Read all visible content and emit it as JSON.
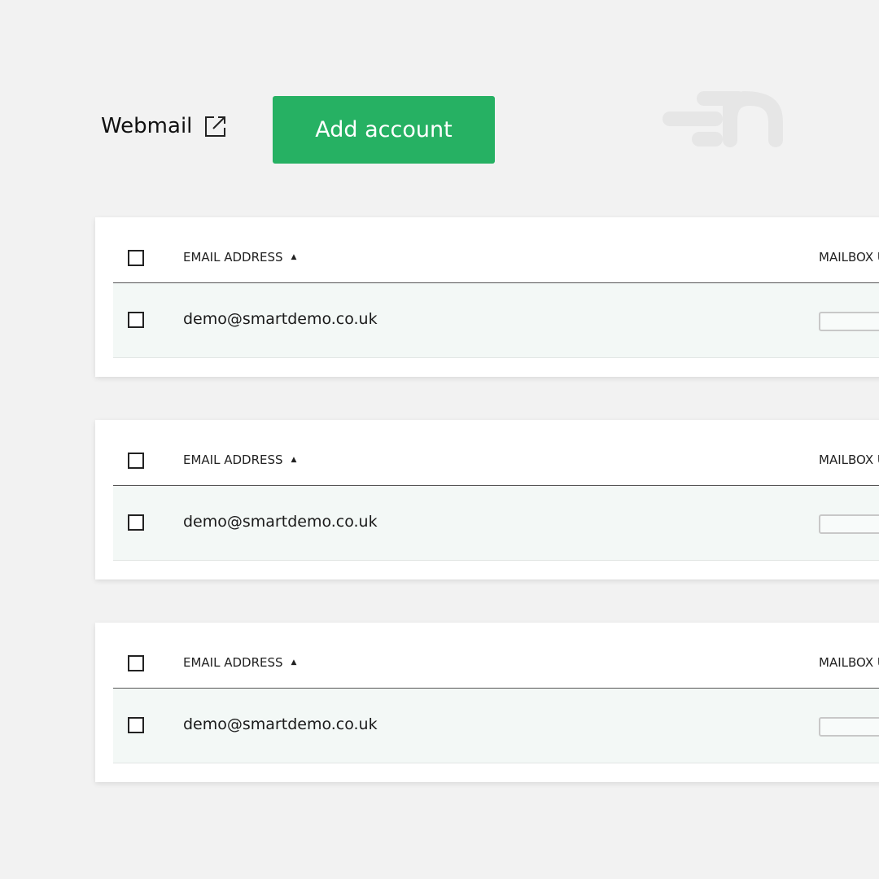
{
  "header": {
    "webmail_label": "Webmail",
    "webmail_icon": "external-link-icon",
    "add_account_label": "Add account",
    "logo_icon": "brand-logo-icon"
  },
  "colors": {
    "accent": "#26b163",
    "background": "#f2f2f2",
    "row_background": "#f3f8f6"
  },
  "tables": [
    {
      "columns": {
        "email": "EMAIL ADDRESS",
        "email_sort": "ascending",
        "mailbox": "MAILBOX U"
      },
      "rows": [
        {
          "email": "demo@smartdemo.co.uk"
        }
      ]
    },
    {
      "columns": {
        "email": "EMAIL ADDRESS",
        "email_sort": "ascending",
        "mailbox": "MAILBOX U"
      },
      "rows": [
        {
          "email": "demo@smartdemo.co.uk"
        }
      ]
    },
    {
      "columns": {
        "email": "EMAIL ADDRESS",
        "email_sort": "ascending",
        "mailbox": "MAILBOX U"
      },
      "rows": [
        {
          "email": "demo@smartdemo.co.uk"
        }
      ]
    }
  ]
}
